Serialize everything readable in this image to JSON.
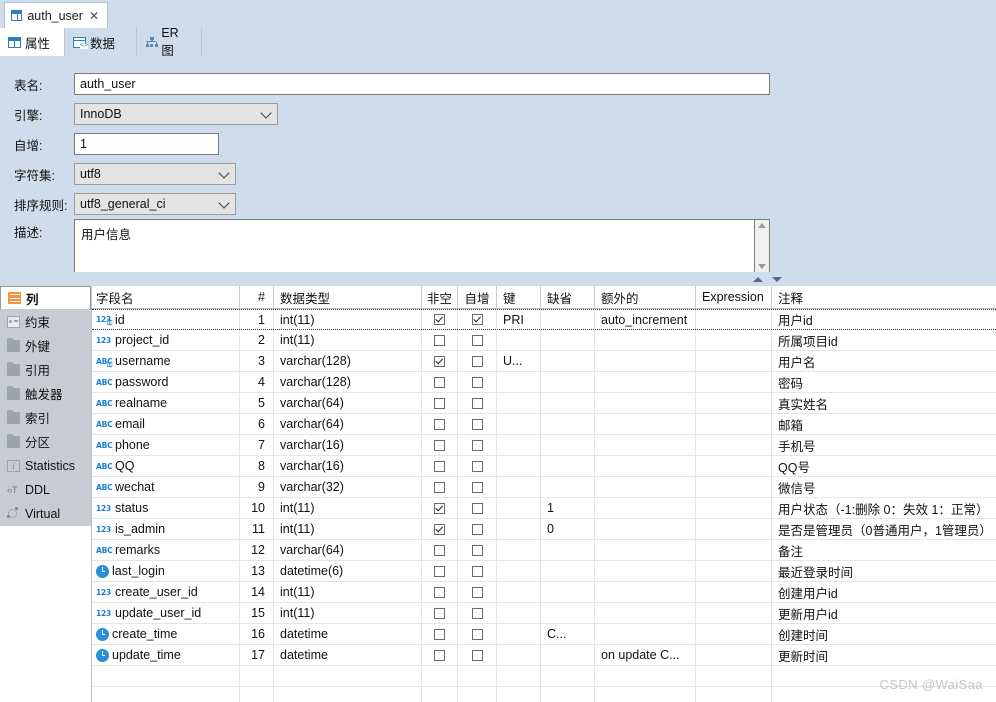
{
  "window": {
    "editor_tab": {
      "title": "auth_user",
      "close": "✕",
      "icon": "table-grid-icon"
    }
  },
  "view_tabs": [
    {
      "label": "属性",
      "icon": "table-grid-icon",
      "active": true
    },
    {
      "label": "数据",
      "icon": "data-grid-icon",
      "active": false
    },
    {
      "label": "ER 图",
      "icon": "er-diagram-icon",
      "active": false
    }
  ],
  "properties": {
    "table_name": {
      "label": "表名:",
      "value": "auth_user"
    },
    "engine": {
      "label": "引擎:",
      "value": "InnoDB"
    },
    "auto_increment": {
      "label": "自增:",
      "value": "1"
    },
    "charset": {
      "label": "字符集:",
      "value": "utf8"
    },
    "collation": {
      "label": "排序规则:",
      "value": "utf8_general_ci"
    },
    "description": {
      "label": "描述:",
      "value": "用户信息"
    }
  },
  "sidebar": {
    "items": [
      {
        "label": "列",
        "icon": "columns-icon",
        "selected": true
      },
      {
        "label": "约束",
        "icon": "constraint-icon",
        "selected": false
      },
      {
        "label": "外键",
        "icon": "folder-icon",
        "selected": false
      },
      {
        "label": "引用",
        "icon": "folder-icon",
        "selected": false
      },
      {
        "label": "触发器",
        "icon": "folder-icon",
        "selected": false
      },
      {
        "label": "索引",
        "icon": "folder-icon",
        "selected": false
      },
      {
        "label": "分区",
        "icon": "folder-icon",
        "selected": false
      },
      {
        "label": "Statistics",
        "icon": "info-icon",
        "selected": false
      },
      {
        "label": "DDL",
        "icon": "ddl-icon",
        "selected": false
      },
      {
        "label": "Virtual",
        "icon": "virtual-icon",
        "selected": false
      }
    ]
  },
  "grid": {
    "columns": [
      "字段名",
      "#",
      "数据类型",
      "非空",
      "自增",
      "键",
      "缺省",
      "额外的",
      "Expression",
      "注释"
    ],
    "rows": [
      {
        "icon": "number-key-icon",
        "name": "id",
        "num": "1",
        "type": "int(11)",
        "notnull": true,
        "autoinc": true,
        "key": "PRI",
        "default": "",
        "extra": "auto_increment",
        "expression": "",
        "comment": "用户id"
      },
      {
        "icon": "number-icon",
        "name": "project_id",
        "num": "2",
        "type": "int(11)",
        "notnull": false,
        "autoinc": false,
        "key": "",
        "default": "",
        "extra": "",
        "expression": "",
        "comment": "所属项目id"
      },
      {
        "icon": "text-key-icon",
        "name": "username",
        "num": "3",
        "type": "varchar(128)",
        "notnull": true,
        "autoinc": false,
        "key": "U...",
        "default": "",
        "extra": "",
        "expression": "",
        "comment": "用户名"
      },
      {
        "icon": "text-icon",
        "name": "password",
        "num": "4",
        "type": "varchar(128)",
        "notnull": false,
        "autoinc": false,
        "key": "",
        "default": "",
        "extra": "",
        "expression": "",
        "comment": "密码"
      },
      {
        "icon": "text-icon",
        "name": "realname",
        "num": "5",
        "type": "varchar(64)",
        "notnull": false,
        "autoinc": false,
        "key": "",
        "default": "",
        "extra": "",
        "expression": "",
        "comment": "真实姓名"
      },
      {
        "icon": "text-icon",
        "name": "email",
        "num": "6",
        "type": "varchar(64)",
        "notnull": false,
        "autoinc": false,
        "key": "",
        "default": "",
        "extra": "",
        "expression": "",
        "comment": "邮箱"
      },
      {
        "icon": "text-icon",
        "name": "phone",
        "num": "7",
        "type": "varchar(16)",
        "notnull": false,
        "autoinc": false,
        "key": "",
        "default": "",
        "extra": "",
        "expression": "",
        "comment": "手机号"
      },
      {
        "icon": "text-icon",
        "name": "QQ",
        "num": "8",
        "type": "varchar(16)",
        "notnull": false,
        "autoinc": false,
        "key": "",
        "default": "",
        "extra": "",
        "expression": "",
        "comment": "QQ号"
      },
      {
        "icon": "text-icon",
        "name": "wechat",
        "num": "9",
        "type": "varchar(32)",
        "notnull": false,
        "autoinc": false,
        "key": "",
        "default": "",
        "extra": "",
        "expression": "",
        "comment": "微信号"
      },
      {
        "icon": "number-icon",
        "name": "status",
        "num": "10",
        "type": "int(11)",
        "notnull": true,
        "autoinc": false,
        "key": "",
        "default": "1",
        "extra": "",
        "expression": "",
        "comment": "用户状态（-1:删除 0：失效 1：正常）"
      },
      {
        "icon": "number-icon",
        "name": "is_admin",
        "num": "11",
        "type": "int(11)",
        "notnull": true,
        "autoinc": false,
        "key": "",
        "default": "0",
        "extra": "",
        "expression": "",
        "comment": "是否是管理员（0普通用户，1管理员）"
      },
      {
        "icon": "text-icon",
        "name": "remarks",
        "num": "12",
        "type": "varchar(64)",
        "notnull": false,
        "autoinc": false,
        "key": "",
        "default": "",
        "extra": "",
        "expression": "",
        "comment": "备注"
      },
      {
        "icon": "datetime-icon",
        "name": "last_login",
        "num": "13",
        "type": "datetime(6)",
        "notnull": false,
        "autoinc": false,
        "key": "",
        "default": "",
        "extra": "",
        "expression": "",
        "comment": "最近登录时间"
      },
      {
        "icon": "number-icon",
        "name": "create_user_id",
        "num": "14",
        "type": "int(11)",
        "notnull": false,
        "autoinc": false,
        "key": "",
        "default": "",
        "extra": "",
        "expression": "",
        "comment": "创建用户id"
      },
      {
        "icon": "number-icon",
        "name": "update_user_id",
        "num": "15",
        "type": "int(11)",
        "notnull": false,
        "autoinc": false,
        "key": "",
        "default": "",
        "extra": "",
        "expression": "",
        "comment": "更新用户id"
      },
      {
        "icon": "datetime-icon",
        "name": "create_time",
        "num": "16",
        "type": "datetime",
        "notnull": false,
        "autoinc": false,
        "key": "",
        "default": "C...",
        "extra": "",
        "expression": "",
        "comment": "创建时间"
      },
      {
        "icon": "datetime-icon",
        "name": "update_time",
        "num": "17",
        "type": "datetime",
        "notnull": false,
        "autoinc": false,
        "key": "",
        "default": "",
        "extra": "on update C...",
        "expression": "",
        "comment": "更新时间"
      }
    ],
    "empty_rows": 2
  },
  "watermark": "CSDN @WaiSaa"
}
